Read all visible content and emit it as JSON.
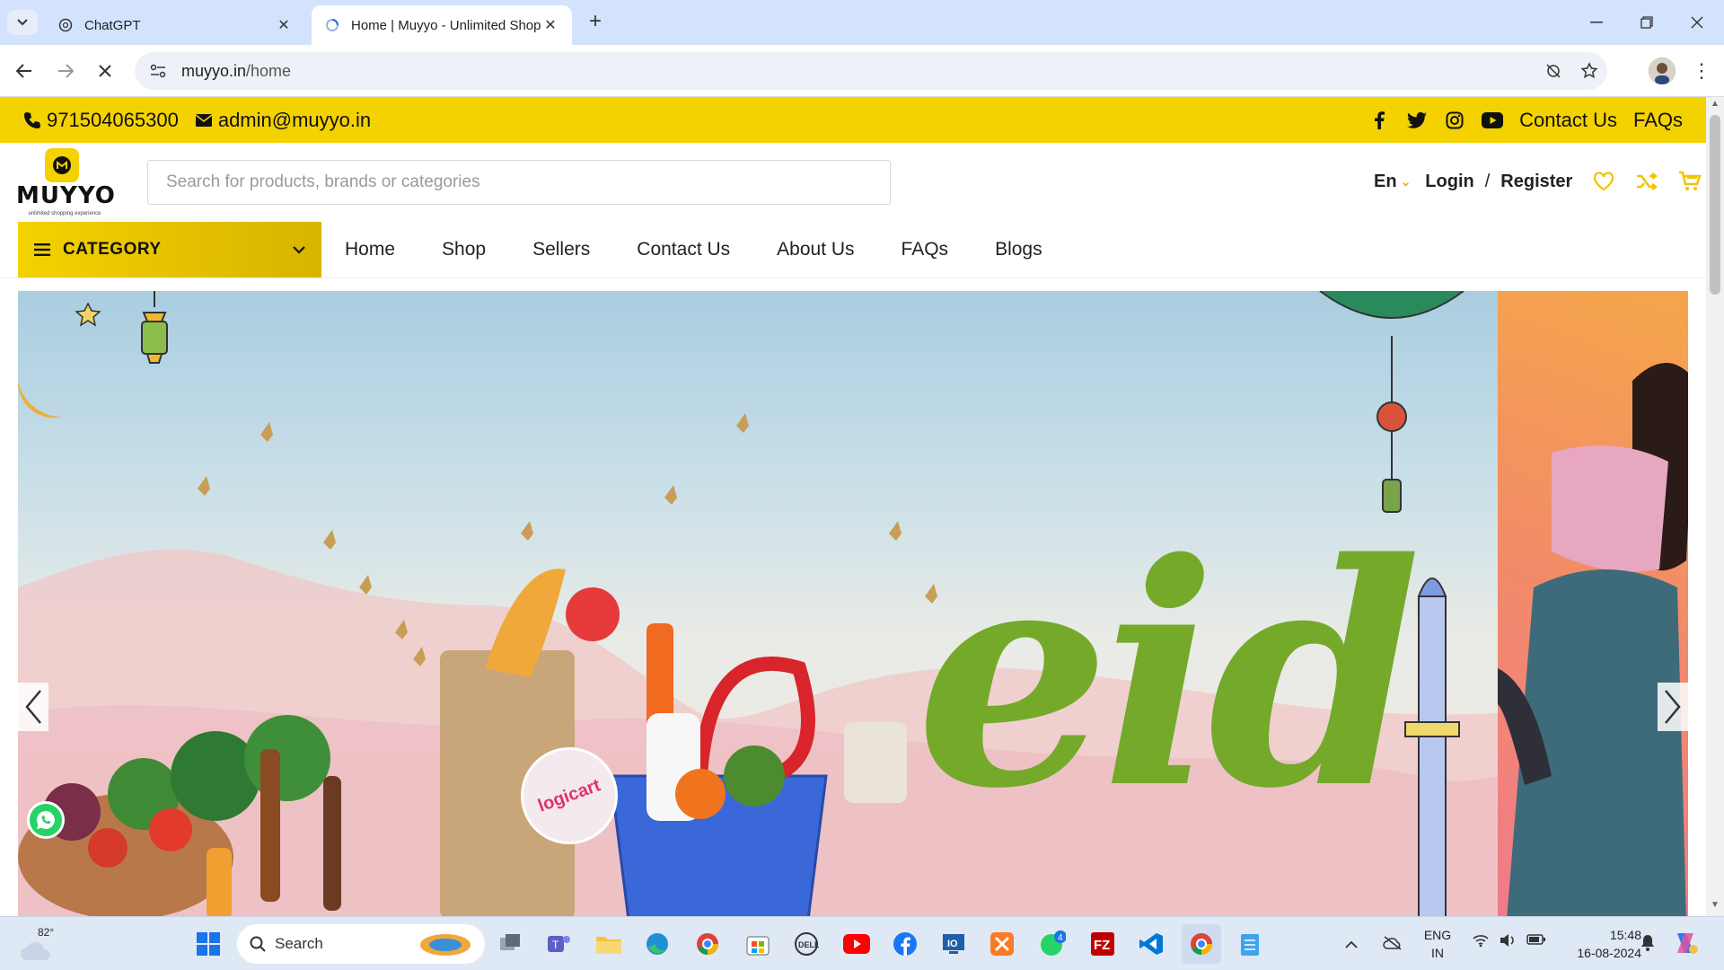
{
  "browser": {
    "tabs": [
      {
        "title": "ChatGPT",
        "active": false
      },
      {
        "title": "Home | Muyyo - Unlimited Shop",
        "active": true
      }
    ],
    "url_host": "muyyo.in",
    "url_path": "/home"
  },
  "topbar": {
    "phone": "971504065300",
    "email": "admin@muyyo.in",
    "links": [
      "Contact Us",
      "FAQs"
    ]
  },
  "header": {
    "logo_text": "MUYYO",
    "logo_tagline": "unlimited shopping experience",
    "search_placeholder": "Search for products, brands or categories",
    "language": "En",
    "login": "Login",
    "separator": "/",
    "register": "Register"
  },
  "nav": {
    "category_label": "CATEGORY",
    "items": [
      "Home",
      "Shop",
      "Sellers",
      "Contact Us",
      "About Us",
      "FAQs",
      "Blogs"
    ]
  },
  "hero": {
    "headline": "eid",
    "badge": "logicart"
  },
  "taskbar": {
    "temperature": "82°",
    "search_label": "Search",
    "lang_line1": "ENG",
    "lang_line2": "IN",
    "time": "15:48",
    "date": "16-08-2024",
    "whatsapp_badge": "4"
  },
  "colors": {
    "brand_yellow": "#f3d200",
    "eid_green": "#74a92a"
  }
}
